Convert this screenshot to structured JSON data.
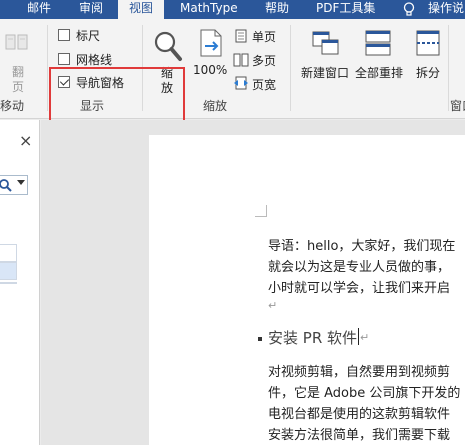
{
  "tabs": [
    {
      "label": "邮件",
      "active": false
    },
    {
      "label": "审阅",
      "active": false
    },
    {
      "label": "视图",
      "active": true
    },
    {
      "label": "MathType",
      "active": false
    },
    {
      "label": "帮助",
      "active": false
    },
    {
      "label": "PDF工具集",
      "active": false
    },
    {
      "label": "操作说",
      "active": false
    }
  ],
  "ribbon": {
    "move_group": {
      "label_top": "翻",
      "label_bottom": "页",
      "group_label": "移动"
    },
    "show_group": {
      "group_label": "显示",
      "ruler": {
        "label": "标尺",
        "checked": false
      },
      "gridlines": {
        "label": "网格线",
        "checked": false
      },
      "nav_pane": {
        "label": "导航窗格",
        "checked": true
      }
    },
    "zoom_group": {
      "group_label": "缩放",
      "zoom_label_1": "缩",
      "zoom_label_2": "放",
      "hundred_label": "100%",
      "one_page": "单页",
      "multi_page": "多页",
      "page_width": "页宽"
    },
    "window_group": {
      "new_window": "新建窗口",
      "arrange_all": "全部重排",
      "split": "拆分",
      "group_label": "窗口"
    }
  },
  "nav_pane": {
    "close": "×"
  },
  "document": {
    "para1_line1": "导语：hello，大家好，我们现在",
    "para1_line2": "就会以为这是专业人员做的事，",
    "para1_line3": "小时就可以学会，让我们来开启",
    "return_mark": "↵",
    "heading": "安装 PR 软件",
    "para2_line1": "对视频剪辑，自然要用到视频剪",
    "para2_line2": "件，它是 Adobe 公司旗下开发的",
    "para2_line3": "电视台都是使用的这款剪辑软件",
    "para2_line4": "安装方法很简单，我们需要下载"
  },
  "colors": {
    "ribbon_tab_bar": "#2b579a",
    "highlight_box": "#e03a3a"
  }
}
